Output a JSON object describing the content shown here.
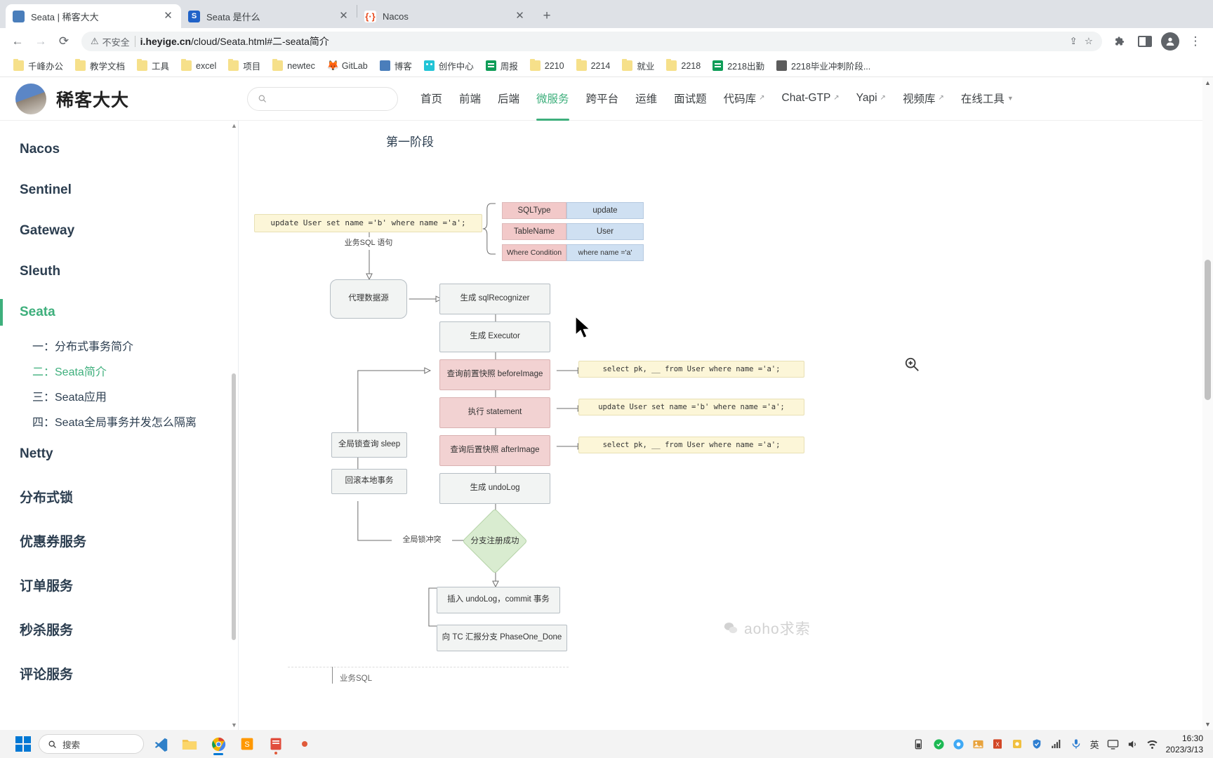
{
  "browser": {
    "tabs": [
      {
        "title": "Seata | 稀客大大",
        "favicon": "photo-icon",
        "active": true
      },
      {
        "title": "Seata 是什么",
        "favicon": "s-icon",
        "active": false
      },
      {
        "title": "Nacos",
        "favicon": "nacos-icon",
        "active": false
      }
    ],
    "newtab_label": "+",
    "nav": {
      "back": "←",
      "forward": "→",
      "reload": "⟳"
    },
    "omnibox": {
      "security_label": "不安全",
      "url_host": "i.heyige.cn",
      "url_path": "/cloud/Seata.html#二-seata简介",
      "share_icon": "share-icon",
      "bookmark_icon": "star-icon"
    },
    "toolbar_right": {
      "extensions_icon": "puzzle-icon",
      "sidepanel_icon": "side-panel-icon",
      "profile_icon": "profile-avatar-icon",
      "menu_icon": "three-dot-menu-icon"
    },
    "bookmarks": [
      {
        "label": "千峰办公",
        "icon": "folder"
      },
      {
        "label": "教学文档",
        "icon": "folder"
      },
      {
        "label": "工具",
        "icon": "folder"
      },
      {
        "label": "excel",
        "icon": "folder"
      },
      {
        "label": "项目",
        "icon": "folder"
      },
      {
        "label": "newtec",
        "icon": "folder"
      },
      {
        "label": "GitLab",
        "icon": "fox"
      },
      {
        "label": "博客",
        "icon": "photo"
      },
      {
        "label": "创作中心",
        "icon": "cyan"
      },
      {
        "label": "周报",
        "icon": "sheet"
      },
      {
        "label": "2210",
        "icon": "folder"
      },
      {
        "label": "2214",
        "icon": "folder"
      },
      {
        "label": "就业",
        "icon": "folder"
      },
      {
        "label": "2218",
        "icon": "folder"
      },
      {
        "label": "2218出勤",
        "icon": "sheet"
      },
      {
        "label": "2218毕业冲刺阶段...",
        "icon": "stone"
      }
    ]
  },
  "site": {
    "logo_text": "稀客大大",
    "search_placeholder": "",
    "nav_items": [
      {
        "label": "首页",
        "external": false,
        "active": false
      },
      {
        "label": "前端",
        "external": false,
        "active": false
      },
      {
        "label": "后端",
        "external": false,
        "active": false
      },
      {
        "label": "微服务",
        "external": false,
        "active": true
      },
      {
        "label": "跨平台",
        "external": false,
        "active": false
      },
      {
        "label": "运维",
        "external": false,
        "active": false
      },
      {
        "label": "面试题",
        "external": false,
        "active": false
      },
      {
        "label": "代码库",
        "external": true,
        "active": false
      },
      {
        "label": "Chat-GTP",
        "external": true,
        "active": false
      },
      {
        "label": "Yapi",
        "external": true,
        "active": false
      },
      {
        "label": "视频库",
        "external": true,
        "active": false
      },
      {
        "label": "在线工具",
        "external": false,
        "active": false,
        "caret": true
      }
    ]
  },
  "sidebar": {
    "groups": [
      {
        "label": "Nacos",
        "active": false,
        "subs": []
      },
      {
        "label": "Sentinel",
        "active": false,
        "subs": []
      },
      {
        "label": "Gateway",
        "active": false,
        "subs": []
      },
      {
        "label": "Sleuth",
        "active": false,
        "subs": []
      },
      {
        "label": "Seata",
        "active": true,
        "subs": [
          {
            "label": "一：分布式事务简介",
            "active": false
          },
          {
            "label": "二：Seata简介",
            "active": true
          },
          {
            "label": "三：Seata应用",
            "active": false
          },
          {
            "label": "四：Seata全局事务并发怎么隔离",
            "active": false
          }
        ]
      },
      {
        "label": "Netty",
        "active": false,
        "subs": []
      },
      {
        "label": "分布式锁",
        "active": false,
        "subs": []
      },
      {
        "label": "优惠券服务",
        "active": false,
        "subs": []
      },
      {
        "label": "订单服务",
        "active": false,
        "subs": []
      },
      {
        "label": "秒杀服务",
        "active": false,
        "subs": []
      },
      {
        "label": "评论服务",
        "active": false,
        "subs": []
      }
    ]
  },
  "content": {
    "phase_title": "第一阶段",
    "watermark": "aoho求索",
    "diagram": {
      "sql_input": "update User set name ='b' where name ='a';",
      "edge_label_sql": "业务SQL 语句",
      "edge_label_conflict": "全局锁冲突",
      "parse_table": [
        {
          "key": "SQLType",
          "value": "update"
        },
        {
          "key": "TableName",
          "value": "User"
        },
        {
          "key": "Where Condition",
          "value": "where name ='a'"
        }
      ],
      "nodes": [
        {
          "id": "datasource",
          "label": "代理数据源",
          "style": "round"
        },
        {
          "id": "sqlrecognizer",
          "label": "生成 sqlRecognizer",
          "style": "plain"
        },
        {
          "id": "executor",
          "label": "生成 Executor",
          "style": "plain"
        },
        {
          "id": "beforeimage",
          "label": "查询前置快照 beforeImage",
          "style": "pink"
        },
        {
          "id": "statement",
          "label": "执行 statement",
          "style": "pink"
        },
        {
          "id": "afterimage",
          "label": "查询后置快照 afterImage",
          "style": "pink"
        },
        {
          "id": "undolog",
          "label": "生成 undoLog",
          "style": "plain"
        },
        {
          "id": "lock_sleep",
          "label": "全局锁查询 sleep",
          "style": "plain"
        },
        {
          "id": "rollback_local",
          "label": "回滚本地事务",
          "style": "plain"
        },
        {
          "id": "branch_register",
          "label": "分支注册成功",
          "style": "diamond"
        },
        {
          "id": "insert_undolog",
          "label": "插入 undoLog，commit 事务",
          "style": "plain"
        },
        {
          "id": "report_tc",
          "label": "向 TC 汇报分支 PhaseOne_Done",
          "style": "plain"
        }
      ],
      "sql_notes": [
        {
          "id": "note_before",
          "text": "select pk, __ from User where name ='a';"
        },
        {
          "id": "note_update",
          "text": "update User set name ='b' where name ='a';"
        },
        {
          "id": "note_after",
          "text": "select pk, __ from User where name ='a';"
        }
      ],
      "bottom_partial_label": "业务SQL"
    }
  },
  "taskbar": {
    "search_placeholder": "搜索",
    "apps": [
      {
        "name": "vscode",
        "label": "VS"
      },
      {
        "name": "file-explorer",
        "label": ""
      },
      {
        "name": "chrome",
        "label": ""
      },
      {
        "name": "sublime",
        "label": "S"
      },
      {
        "name": "app-red",
        "label": ""
      },
      {
        "name": "app-dot",
        "label": ""
      }
    ],
    "tray": [
      "battery-icon",
      "onedrive-icon",
      "dropbox-icon",
      "picture-icon",
      "excel-icon",
      "app-icon",
      "shield-icon",
      "network-icon",
      "mic-icon"
    ],
    "ime": "英",
    "time": "16:30",
    "date": "2023/3/13"
  }
}
